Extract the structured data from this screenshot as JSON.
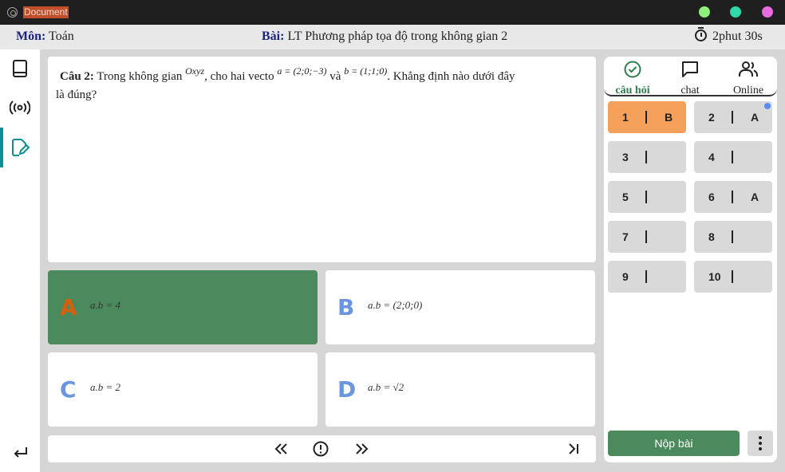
{
  "window": {
    "title": "Document",
    "dot_colors": [
      "#8ef07a",
      "#2ed8a8",
      "#e86be0"
    ]
  },
  "header": {
    "subject_label": "Môn:",
    "subject_value": "Toán",
    "lesson_label": "Bài:",
    "lesson_value": "LT Phương pháp tọa độ trong không gian 2",
    "timer": "2phut 30s"
  },
  "sidebar": {
    "items": [
      "book-icon",
      "broadcast-icon",
      "edit-document-icon"
    ],
    "bottom": "return-icon",
    "accent": "#0a8f94"
  },
  "question": {
    "label": "Câu 2:",
    "text_1": "Trong không gian",
    "space": "Oxyz",
    "text_2": ", cho hai vecto",
    "vec_a": "a = (2;0;−3)",
    "conj": "và",
    "vec_b": "b = (1;1;0)",
    "text_3": ". Khẳng định nào dưới đây",
    "text_4": "là đúng?"
  },
  "answers": [
    {
      "letter": "A",
      "text": "a.b = 4",
      "selected": true
    },
    {
      "letter": "B",
      "text": "a.b = (2;0;0)",
      "selected": false
    },
    {
      "letter": "C",
      "text": "a.b = 2",
      "selected": false
    },
    {
      "letter": "D",
      "text": "a.b = √2",
      "selected": false
    }
  ],
  "navigation": {
    "prev": "«",
    "info": "!",
    "next": "»",
    "last": "›|"
  },
  "right_panel": {
    "tabs": [
      {
        "label": "câu hỏi",
        "icon": "check-circle-icon",
        "active": true
      },
      {
        "label": "chat",
        "icon": "chat-icon",
        "active": false
      },
      {
        "label": "Online",
        "icon": "users-icon",
        "active": false
      }
    ],
    "questions": [
      {
        "num": "1",
        "ans": "B",
        "current": true
      },
      {
        "num": "2",
        "ans": "A",
        "badge": true
      },
      {
        "num": "3",
        "ans": ""
      },
      {
        "num": "4",
        "ans": ""
      },
      {
        "num": "5",
        "ans": ""
      },
      {
        "num": "6",
        "ans": "A"
      },
      {
        "num": "7",
        "ans": ""
      },
      {
        "num": "8",
        "ans": ""
      },
      {
        "num": "9",
        "ans": ""
      },
      {
        "num": "10",
        "ans": ""
      }
    ],
    "submit_label": "Nộp bài",
    "more_icon": "more-vertical-icon"
  }
}
